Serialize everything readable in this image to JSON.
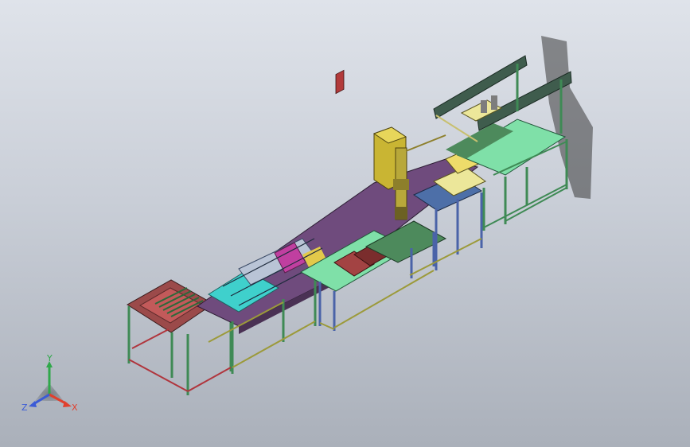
{
  "viewport": {
    "colors": {
      "background_top": "#dfe3ea",
      "background_bottom": "#aab0ba",
      "frame_green": "#3f8a55",
      "frame_blue": "#4a63a8",
      "frame_red": "#b0353d",
      "frame_olive": "#9c9a3a",
      "table_purple": "#7a4f86",
      "plate_mint": "#7fe0a8",
      "plate_cyan": "#43d0cf",
      "press_yellow": "#c9b533",
      "clamp_yellow": "#ece79a",
      "shadow": "#3a3a3a"
    }
  },
  "triad": {
    "y_label": "Y",
    "x_label": "X",
    "z_label": "Z",
    "y_color": "#2fa84a",
    "x_color": "#e0402e",
    "z_color": "#3b5bd6"
  }
}
